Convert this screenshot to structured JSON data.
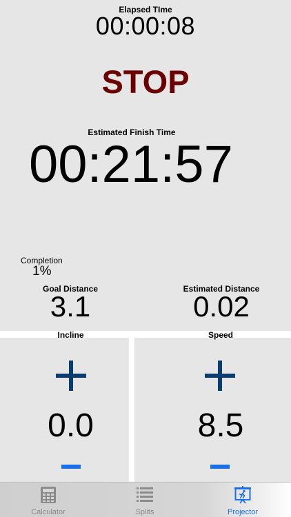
{
  "elapsed": {
    "label": "Elapsed TIme",
    "value": "00:00:08"
  },
  "stop_button": {
    "label": "STOP"
  },
  "finish": {
    "label": "Estimated Finish Time",
    "value": "00:21:57"
  },
  "completion": {
    "label": "Completion",
    "value": "1%"
  },
  "goal_distance": {
    "label": "Goal Distance",
    "value": "3.1"
  },
  "estimated_distance": {
    "label": "Estimated Distance",
    "value": "0.02"
  },
  "incline": {
    "label": "Incline",
    "value": "0.0",
    "plus_icon": "plus-icon",
    "minus_icon": "minus-icon"
  },
  "speed": {
    "label": "Speed",
    "value": "8.5",
    "plus_icon": "plus-icon",
    "minus_icon": "minus-icon"
  },
  "tabs": [
    {
      "label": "Calculator",
      "icon": "calculator-icon",
      "active": false
    },
    {
      "label": "Splits",
      "icon": "list-icon",
      "active": false
    },
    {
      "label": "Projector",
      "icon": "projector-runner-icon",
      "active": true
    }
  ],
  "colors": {
    "stop": "#6b0000",
    "plus": "#0a3d6e",
    "minus": "#1a6fe8",
    "active_tab": "#1a6fe8",
    "inactive_tab": "#8a8a8a",
    "panel_bg": "#e6e6e6"
  }
}
